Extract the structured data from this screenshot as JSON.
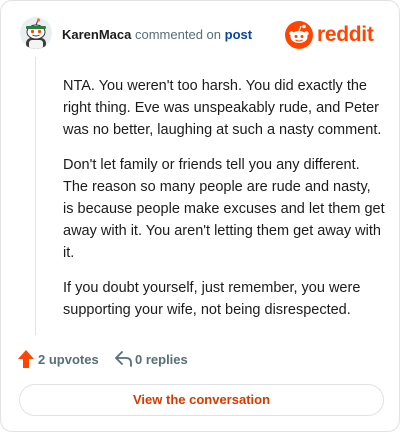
{
  "header": {
    "username": "KarenMaca",
    "action_text": "commented on",
    "post_link": "post",
    "brand_name": "reddit"
  },
  "comment": {
    "paragraphs": [
      "NTA. You weren't too harsh. You did exactly the right thing. Eve was unspeakably rude, and Peter was no better, laughing at such a nasty comment.",
      "Don't let family or friends tell you any different. The reason so many people are rude and nasty, is because people make excuses and let them get away with it. You aren't letting them get away with it.",
      "If you doubt yourself, just remember, you were supporting your wife, not being disrespected."
    ]
  },
  "actions": {
    "upvotes_label": "2 upvotes",
    "replies_label": "0 replies"
  },
  "cta": {
    "label": "View the conversation"
  },
  "icons": {
    "avatar": "snoo-avatar-icon",
    "brand": "reddit-logo-icon",
    "upvote": "upvote-arrow-icon",
    "reply": "reply-arrow-icon"
  },
  "colors": {
    "brand_orange": "#ff4500",
    "link_blue": "#0a449b",
    "muted_text": "#576f76",
    "cta_text": "#d93900"
  }
}
